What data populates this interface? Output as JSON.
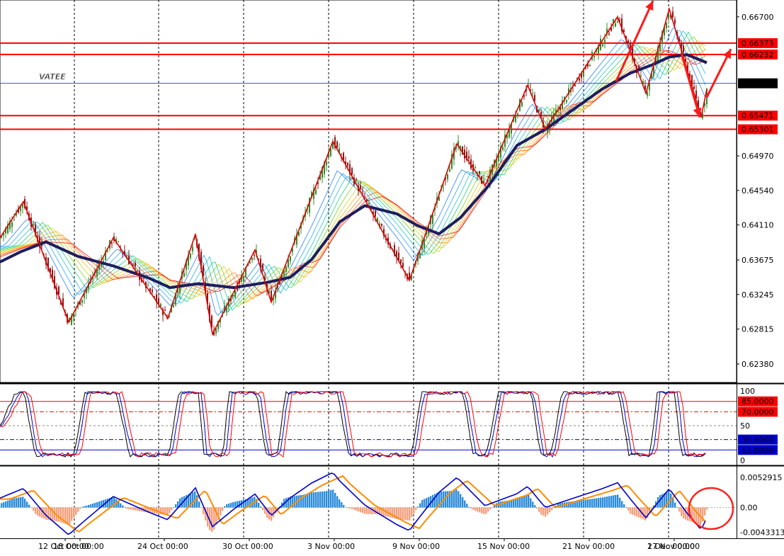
{
  "watermark": "VATEE",
  "colors": {
    "bull": "#2e8b2e",
    "bear": "#8b1a1a",
    "slow_ma": "#1e1e5e",
    "level_line": "#ff0000",
    "current_price_line": "#3355cc",
    "zigzag": "#e00000",
    "hist_positive": "#2b8cd9",
    "hist_negative": "#f4a07c",
    "macd_line": "#0000cc",
    "signal_line": "#ff8c00"
  },
  "chart_data": [
    {
      "type": "candlestick",
      "pane": "price",
      "y_ticks": [
        "0.66700",
        "0.66373",
        "0.66232",
        "0.65873",
        "0.65471",
        "0.65301",
        "0.64970",
        "0.64540",
        "0.64110",
        "0.63675",
        "0.63245",
        "0.62815",
        "0.62380"
      ],
      "ylim": [
        0.6215,
        0.6691
      ],
      "x_ticks": [
        "12 Oct 00:00",
        "18 Oct 00:00",
        "24 Oct 00:00",
        "30 Oct 00:00",
        "3 Nov 00:00",
        "9 Nov 00:00",
        "15 Nov 00:00",
        "21 Nov 00:00",
        "27 Nov 00:00",
        "1 Dec 00:00"
      ],
      "horizontal_levels": [
        {
          "value": 0.66373,
          "label": "0.66373"
        },
        {
          "value": 0.66232,
          "label": "0.66232"
        },
        {
          "value": 0.65471,
          "label": "0.65471"
        },
        {
          "value": 0.65301,
          "label": "0.65301"
        }
      ],
      "current_price": {
        "value": 0.65873,
        "label": "0.65873"
      },
      "zigzag_points": [
        [
          0,
          0.6395
        ],
        [
          33,
          0.644
        ],
        [
          97,
          0.629
        ],
        [
          160,
          0.6395
        ],
        [
          237,
          0.6295
        ],
        [
          276,
          0.64
        ],
        [
          300,
          0.6275
        ],
        [
          360,
          0.638
        ],
        [
          383,
          0.6315
        ],
        [
          470,
          0.6515
        ],
        [
          578,
          0.6342
        ],
        [
          645,
          0.6512
        ],
        [
          685,
          0.646
        ],
        [
          745,
          0.6585
        ],
        [
          770,
          0.653
        ],
        [
          872,
          0.667
        ],
        [
          912,
          0.6575
        ],
        [
          945,
          0.668
        ],
        [
          990,
          0.6545
        ],
        [
          998,
          0.658
        ]
      ],
      "slow_ma_points": [
        [
          0,
          0.6365
        ],
        [
          30,
          0.6378
        ],
        [
          65,
          0.639
        ],
        [
          110,
          0.6372
        ],
        [
          160,
          0.636
        ],
        [
          210,
          0.6345
        ],
        [
          240,
          0.6333
        ],
        [
          280,
          0.6338
        ],
        [
          330,
          0.6333
        ],
        [
          380,
          0.634
        ],
        [
          410,
          0.6346
        ],
        [
          440,
          0.6368
        ],
        [
          480,
          0.6415
        ],
        [
          515,
          0.6435
        ],
        [
          560,
          0.6425
        ],
        [
          590,
          0.641
        ],
        [
          620,
          0.64
        ],
        [
          650,
          0.642
        ],
        [
          690,
          0.646
        ],
        [
          730,
          0.651
        ],
        [
          770,
          0.653
        ],
        [
          810,
          0.6555
        ],
        [
          850,
          0.658
        ],
        [
          890,
          0.66
        ],
        [
          920,
          0.661
        ],
        [
          945,
          0.662
        ],
        [
          970,
          0.6623
        ],
        [
          998,
          0.6613
        ]
      ],
      "arrows": [
        {
          "from": [
            870,
            0.659
          ],
          "to": [
            922,
            0.669
          ]
        },
        {
          "from": [
            962,
            0.6625
          ],
          "to": [
            988,
            0.6545
          ]
        },
        {
          "from": [
            998,
            0.657
          ],
          "to": [
            1032,
            0.663
          ]
        }
      ]
    },
    {
      "type": "line",
      "pane": "stochastic",
      "ylim": [
        0,
        100
      ],
      "y_ticks": [
        "100",
        "50",
        "0"
      ],
      "levels": [
        {
          "value": 85,
          "label": "85.0000",
          "color": "#ff0000"
        },
        {
          "value": 70,
          "label": "70.0000",
          "color": "#ff0000"
        },
        {
          "value": 30,
          "label": "30.0000",
          "color": "#0000cc"
        },
        {
          "value": 15,
          "label": "15.0000",
          "color": "#0000cc"
        }
      ]
    },
    {
      "type": "bar",
      "pane": "macd",
      "y_ticks": [
        "0.0052915",
        "0.00",
        "-0.0043313"
      ],
      "ylim": [
        -0.0049,
        0.0059
      ]
    }
  ]
}
